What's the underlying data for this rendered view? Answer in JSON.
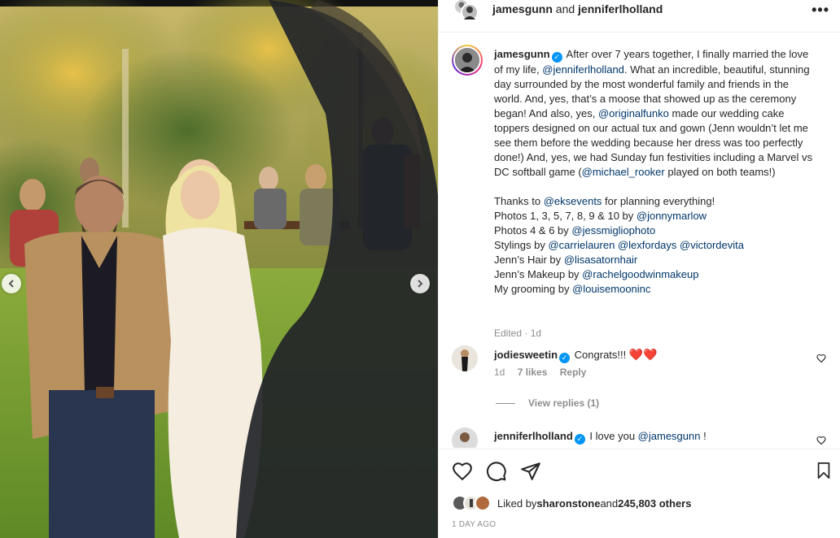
{
  "header": {
    "user1": "jamesgunn",
    "and_text": " and ",
    "user2": "jenniferlholland",
    "more": "•••"
  },
  "caption": {
    "username": "jamesgunn",
    "segments": [
      {
        "t": " After over 7 years together, I finally married the love of my life, ",
        "link": false
      },
      {
        "t": "@jenniferlholland",
        "link": true
      },
      {
        "t": ". What an incredible, beautiful, stunning day surrounded by the most wonderful family and friends in the world. And, yes, that’s a moose that showed up as the ceremony began! And also, yes, ",
        "link": false
      },
      {
        "t": "@originalfunko",
        "link": true
      },
      {
        "t": " made our wedding cake toppers designed on our actual tux and gown (Jenn wouldn’t let me see them before the wedding because her dress was too perfectly done!) And, yes, we had Sunday fun festivities including a Marvel vs DC softball game (",
        "link": false
      },
      {
        "t": "@michael_rooker",
        "link": true
      },
      {
        "t": " played on both teams!)",
        "link": false
      }
    ],
    "credits": [
      [
        {
          "t": "Thanks to ",
          "link": false
        },
        {
          "t": "@eksevents",
          "link": true
        },
        {
          "t": " for planning everything!",
          "link": false
        }
      ],
      [
        {
          "t": "Photos 1, 3, 5, 7, 8, 9 & 10 by ",
          "link": false
        },
        {
          "t": "@jonnymarlow",
          "link": true
        }
      ],
      [
        {
          "t": "Photos 4 & 6 by ",
          "link": false
        },
        {
          "t": "@jessmigliophoto",
          "link": true
        }
      ],
      [
        {
          "t": "Stylings by ",
          "link": false
        },
        {
          "t": "@carrielauren",
          "link": true
        },
        {
          "t": " ",
          "link": false
        },
        {
          "t": "@lexfordays",
          "link": true
        },
        {
          "t": " ",
          "link": false
        },
        {
          "t": "@victordevita",
          "link": true
        }
      ],
      [
        {
          "t": "Jenn’s Hair by ",
          "link": false
        },
        {
          "t": "@lisasatornhair",
          "link": true
        }
      ],
      [
        {
          "t": "Jenn’s Makeup by ",
          "link": false
        },
        {
          "t": "@rachelgoodwinmakeup",
          "link": true
        }
      ],
      [
        {
          "t": "My grooming by ",
          "link": false
        },
        {
          "t": "@louisemooninc",
          "link": true
        }
      ]
    ],
    "meta": "Edited · 1d"
  },
  "comments": [
    {
      "username": "jodiesweetin",
      "text": "Congrats!!! ",
      "emoji": "❤️❤️",
      "time": "1d",
      "likes": "7 likes",
      "reply": "Reply",
      "view_replies": "View replies (1)"
    },
    {
      "username": "jenniferlholland",
      "text_before": " I love you ",
      "mention": "@jamesgunn",
      "text_after": " !"
    }
  ],
  "likes": {
    "prefix": "Liked by ",
    "user": "sharonstone",
    "middle": " and ",
    "count": "245,803 others"
  },
  "date": "1 DAY AGO",
  "icons": [
    "chevron-left-icon",
    "chevron-right-icon",
    "heart-icon",
    "comment-icon",
    "share-icon",
    "bookmark-icon",
    "more-icon",
    "verified-icon"
  ],
  "colors": {
    "link": "#00376b",
    "verified": "#0095f6",
    "meta": "#8e8e8e",
    "heart": "#ed4956"
  }
}
